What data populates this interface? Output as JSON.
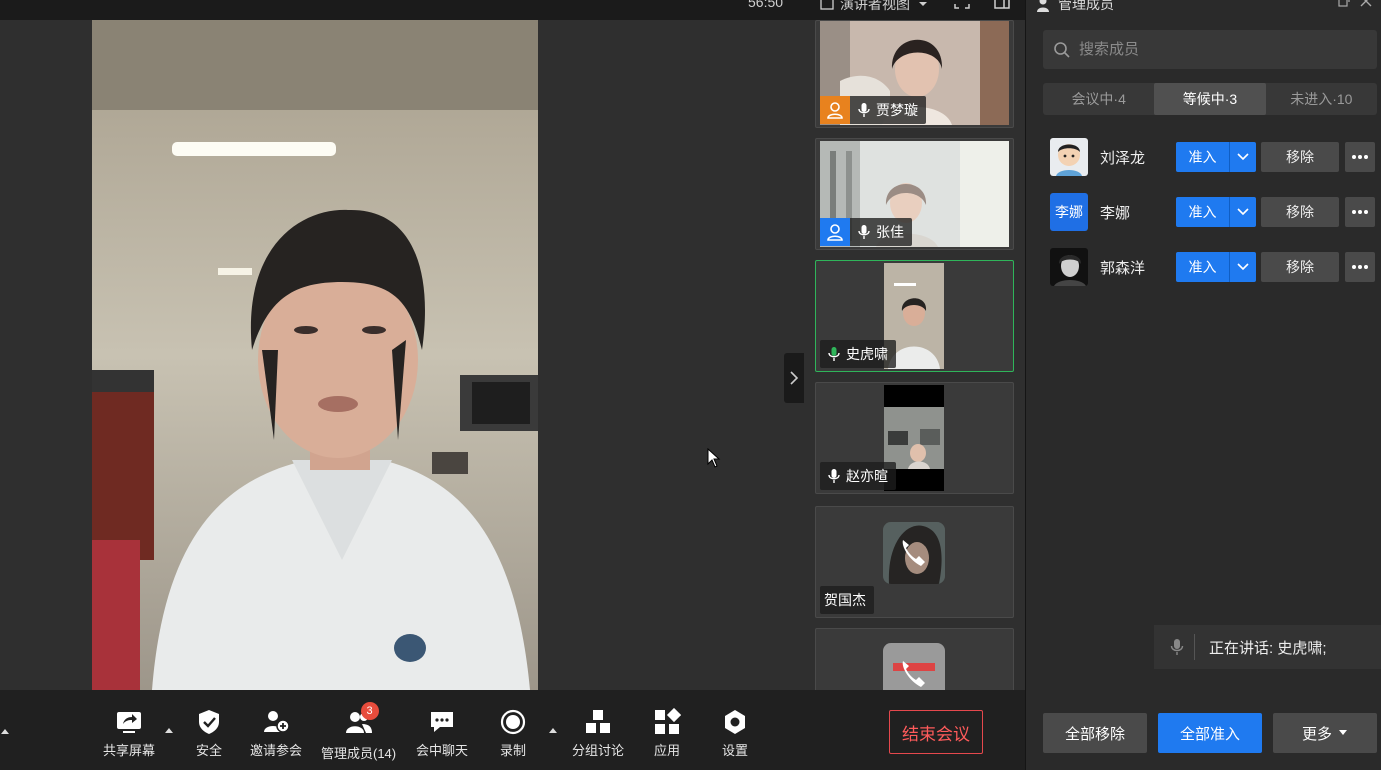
{
  "topbar": {
    "timer": "56:50",
    "view_mode": "演讲者视图"
  },
  "gallery": {
    "tiles": [
      {
        "name": "贾梦璇",
        "host": true,
        "mic": true
      },
      {
        "name": "张佳",
        "host": true,
        "mic": true
      },
      {
        "name": "史虎啸",
        "active_speaker": true,
        "mic": true,
        "mic_color": "#2fb55a"
      },
      {
        "name": "赵亦暄",
        "mic": true
      },
      {
        "name": "贺国杰",
        "phone": true
      },
      {
        "name": "",
        "phone": true
      }
    ]
  },
  "toolbar": {
    "share": "共享屏幕",
    "security": "安全",
    "invite": "邀请参会",
    "manage": "管理成员(14)",
    "manage_badge": "3",
    "chat": "会中聊天",
    "record": "录制",
    "breakout": "分组讨论",
    "apps": "应用",
    "settings": "设置",
    "end_meeting": "结束会议"
  },
  "panel": {
    "title": "管理成员",
    "search_placeholder": "搜索成员",
    "tabs": [
      "会议中·4",
      "等候中·3",
      "未进入·10"
    ],
    "selected_tab": 1,
    "waiting": [
      {
        "name": "刘泽龙",
        "admit": "准入",
        "remove": "移除"
      },
      {
        "name": "李娜",
        "avatar_text": "李娜",
        "admit": "准入",
        "remove": "移除"
      },
      {
        "name": "郭森洋",
        "admit": "准入",
        "remove": "移除"
      }
    ],
    "speaking_label": "正在讲话: 史虎啸;",
    "remove_all": "全部移除",
    "admit_all": "全部准入",
    "more": "更多"
  },
  "colors": {
    "accent": "#1f7af0",
    "danger": "#e5484d",
    "active_tile": "#2fb55a"
  }
}
